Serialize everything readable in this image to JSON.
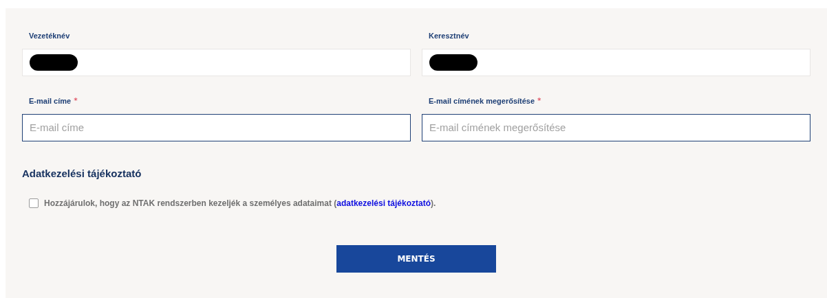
{
  "fields": [
    {
      "label": "Vezetéknév",
      "required": false,
      "redacted": true,
      "emphasized": false
    },
    {
      "label": "Keresztnév",
      "required": false,
      "redacted": true,
      "emphasized": false
    },
    {
      "label": "E-mail címe",
      "required": true,
      "placeholder": "E-mail címe",
      "redacted": false,
      "emphasized": true
    },
    {
      "label": "E-mail címének megerősítése",
      "required": true,
      "placeholder": "E-mail címének megerősítése",
      "redacted": false,
      "emphasized": true
    }
  ],
  "required_mark": "*",
  "privacy": {
    "heading": "Adatkezelési tájékoztató",
    "consent": {
      "checked": false,
      "text_before": "Hozzájárulok, hogy az NTAK rendszerben kezeljék a személyes adataimat (",
      "link": "adatkezelési tájékoztató",
      "text_after": ")."
    }
  },
  "save_button": "MENTÉS"
}
